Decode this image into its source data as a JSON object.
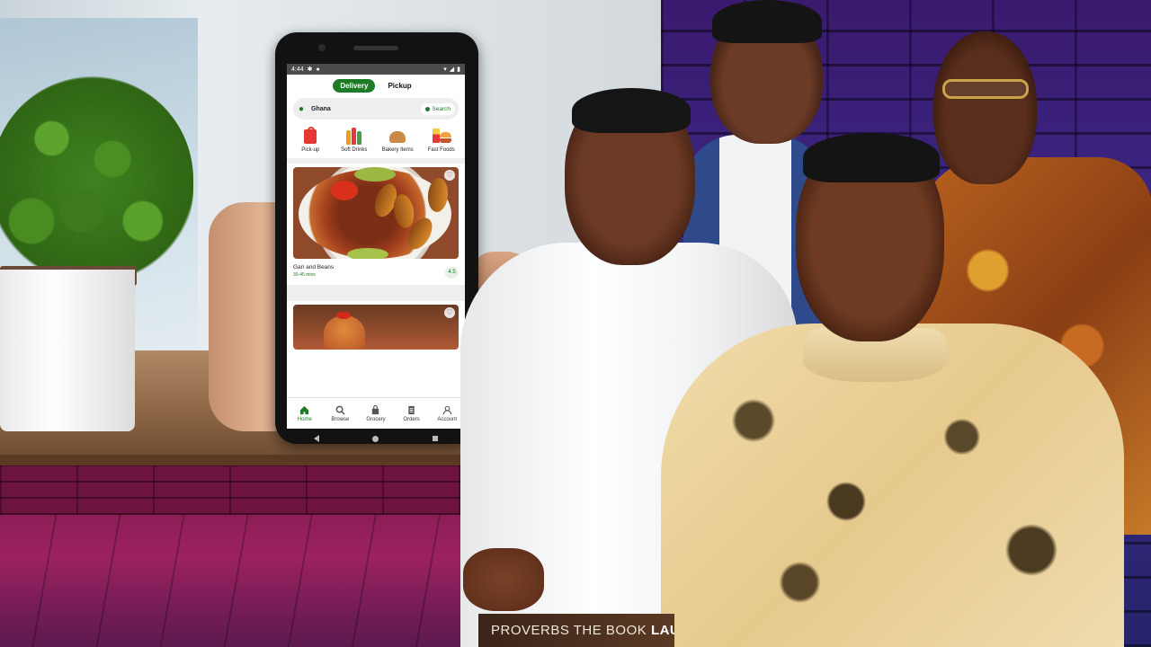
{
  "phone": {
    "status_time": "4:44",
    "mode_toggle": {
      "delivery": "Delivery",
      "pickup": "Pickup"
    },
    "search": {
      "location": "Ghana",
      "button": "Search"
    },
    "categories": [
      {
        "label": "Pick-up",
        "icon": "shopping-bag-icon"
      },
      {
        "label": "Soft Drinks",
        "icon": "bottles-icon"
      },
      {
        "label": "Bakery Items",
        "icon": "bread-icon"
      },
      {
        "label": "Fast Foods",
        "icon": "burger-icon"
      }
    ],
    "food_cards": [
      {
        "name": "Gari and Beans",
        "time": "30-45 mins",
        "rating": "4.5"
      }
    ],
    "bottom_nav": [
      {
        "label": "Home",
        "icon": "home-icon",
        "active": true
      },
      {
        "label": "Browse",
        "icon": "search-icon"
      },
      {
        "label": "Grocery",
        "icon": "bag-icon"
      },
      {
        "label": "Orders",
        "icon": "receipt-icon"
      },
      {
        "label": "Account",
        "icon": "user-icon"
      }
    ],
    "accent_color": "#1d7a25"
  },
  "banner": {
    "text_light": "PROVERBS THE BOOK ",
    "text_bold": "LAUNC"
  }
}
